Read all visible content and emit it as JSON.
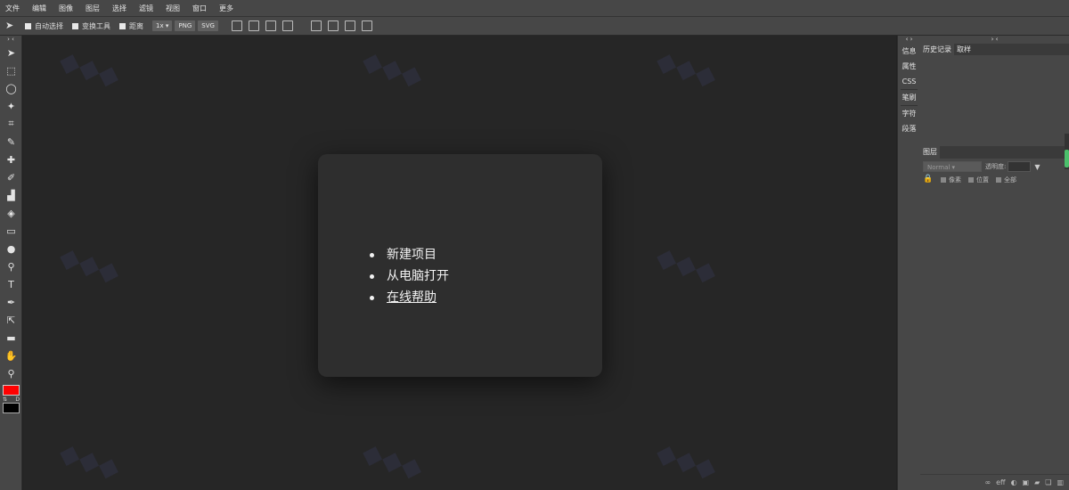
{
  "menu": [
    "文件",
    "编辑",
    "图像",
    "图层",
    "选择",
    "滤镜",
    "视图",
    "窗口",
    "更多"
  ],
  "options": {
    "auto_select": "自动选择",
    "transform_tools": "变换工具",
    "distance": "距离",
    "zoom": "1x",
    "png": "PNG",
    "svg": "SVG"
  },
  "collapse_left": "› ‹",
  "collapse_right_mini": "‹ ›",
  "collapse_right": "› ‹",
  "tools": [
    "move-tool",
    "marquee-tool",
    "lasso-tool",
    "magic-wand-tool",
    "crop-tool",
    "eyedropper-tool",
    "healing-brush-tool",
    "brush-tool",
    "clone-stamp-tool",
    "eraser-tool",
    "gradient-tool",
    "blur-tool",
    "dodge-tool",
    "type-tool",
    "pen-tool",
    "path-select-tool",
    "shape-tool",
    "hand-tool",
    "zoom-tool"
  ],
  "colors": {
    "foreground": "#ff0000",
    "background": "#000000",
    "accent": "#4bbf6b"
  },
  "swap_label": "⇅",
  "default_label": "D",
  "dialog": {
    "items": [
      "新建项目",
      "从电脑打开",
      "在线帮助"
    ]
  },
  "mini_panel": [
    "信息",
    "属性",
    "CSS",
    "笔刷",
    "字符",
    "段落"
  ],
  "top_tabs": [
    "历史记录",
    "取样"
  ],
  "layers_tab": "图层",
  "blend_mode": "Normal",
  "opacity_label": "透明度:",
  "lock_items": [
    "像素",
    "位置",
    "全部"
  ],
  "bottom_icons": [
    "link-icon",
    "effects-icon",
    "mask-icon",
    "adjustment-icon",
    "folder-icon",
    "new-layer-icon",
    "trash-icon"
  ],
  "bottom_eff_label": "eff"
}
